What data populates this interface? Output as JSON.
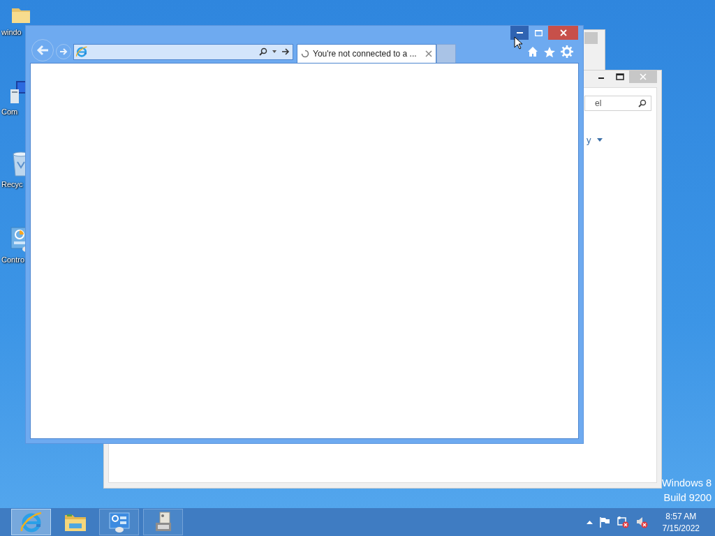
{
  "desktop_icons": [
    {
      "kind": "folder",
      "label": "windo"
    },
    {
      "kind": "computer",
      "label": "Com"
    },
    {
      "kind": "recycle-bin",
      "label": "Recyc"
    },
    {
      "kind": "control-panel",
      "label": "Contro"
    }
  ],
  "control_panel_window": {
    "search": {
      "value": "el"
    },
    "view_by": {
      "value": "y"
    }
  },
  "browser": {
    "caption_buttons": [
      {
        "kind": "minimize",
        "hovered": true
      },
      {
        "kind": "maximize",
        "hovered": false
      },
      {
        "kind": "close",
        "hovered": false
      }
    ],
    "tab": {
      "title": "You're not connected to a ...",
      "loading": true
    }
  },
  "watermark": [
    "Windows 8",
    "Build 9200"
  ],
  "taskbar": {
    "apps": [
      {
        "kind": "browser",
        "selected": true,
        "running": true
      },
      {
        "kind": "folder",
        "selected": false,
        "running": false
      },
      {
        "kind": "control-panel",
        "selected": false,
        "running": true
      },
      {
        "kind": "device",
        "selected": false,
        "running": true
      }
    ],
    "tray": [
      {
        "kind": "up-arrow"
      },
      {
        "kind": "flag"
      },
      {
        "kind": "network-error"
      },
      {
        "kind": "speaker-error"
      }
    ],
    "clock": {
      "time": "8:57 AM",
      "date": "7/15/2022"
    }
  }
}
